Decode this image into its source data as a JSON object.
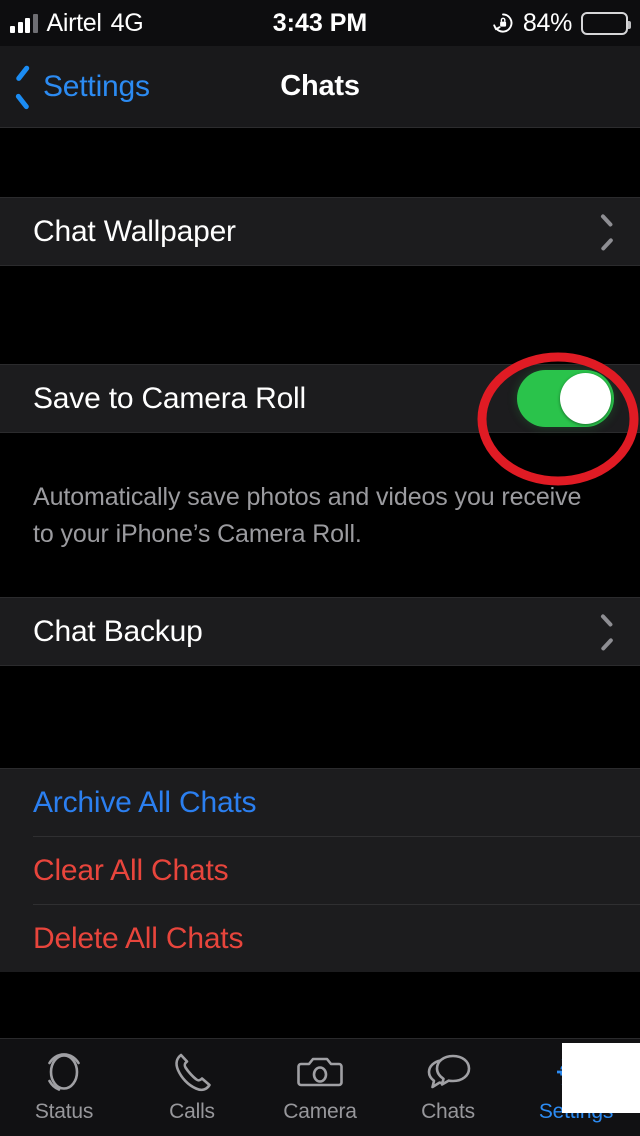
{
  "status_bar": {
    "carrier": "Airtel",
    "network": "4G",
    "time": "3:43 PM",
    "battery_percent": "84%",
    "battery_level": 84,
    "signal_bars_filled": 3,
    "signal_bars_total": 4,
    "rotation_lock_icon": "rotation-lock-icon",
    "battery_icon": "battery-icon"
  },
  "nav": {
    "back_label": "Settings",
    "back_icon": "chevron-left-icon",
    "title": "Chats"
  },
  "groups": [
    {
      "rows": [
        {
          "label": "Chat Wallpaper",
          "type": "disclosure",
          "accessory_icon": "chevron-right-icon"
        }
      ]
    },
    {
      "rows": [
        {
          "label": "Save to Camera Roll",
          "type": "toggle",
          "toggle_on": true
        }
      ],
      "footer": "Automatically save photos and videos you receive to your iPhone’s Camera Roll."
    },
    {
      "rows": [
        {
          "label": "Chat Backup",
          "type": "disclosure",
          "accessory_icon": "chevron-right-icon"
        }
      ]
    },
    {
      "rows": [
        {
          "label": "Archive All Chats",
          "type": "action",
          "style": "blue"
        },
        {
          "label": "Clear All Chats",
          "type": "action",
          "style": "red"
        },
        {
          "label": "Delete All Chats",
          "type": "action",
          "style": "red"
        }
      ]
    }
  ],
  "tab_bar": {
    "tabs": [
      {
        "label": "Status",
        "icon": "status-ring-icon",
        "active": false
      },
      {
        "label": "Calls",
        "icon": "phone-icon",
        "active": false
      },
      {
        "label": "Camera",
        "icon": "camera-icon",
        "active": false
      },
      {
        "label": "Chats",
        "icon": "chat-bubbles-icon",
        "active": false
      },
      {
        "label": "Settings",
        "icon": "gear-icon",
        "active": true
      }
    ]
  },
  "annotation": {
    "shape": "ellipse",
    "color": "#e01b24",
    "target": "save-to-camera-roll-toggle"
  },
  "colors": {
    "page_background": "#000000",
    "row_background": "#1c1c1e",
    "accent_blue": "#2c8bf2",
    "destructive_red": "#e8453c",
    "toggle_on_green": "#2ac34b",
    "secondary_text": "#9b9b9f",
    "annotation_red": "#e01b24"
  }
}
